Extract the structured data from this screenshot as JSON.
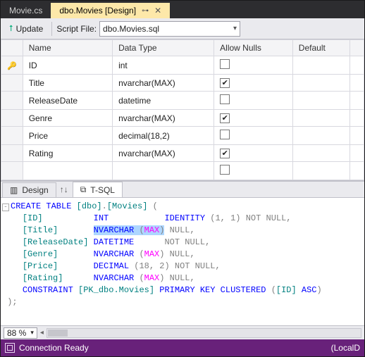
{
  "tabs": {
    "inactive": "Movie.cs",
    "active": "dbo.Movies [Design]"
  },
  "toolbar": {
    "update": "Update",
    "scriptFileLabel": "Script File:",
    "scriptFileValue": "dbo.Movies.sql"
  },
  "grid": {
    "headers": {
      "name": "Name",
      "dataType": "Data Type",
      "allowNulls": "Allow Nulls",
      "default": "Default"
    },
    "rows": [
      {
        "key": true,
        "name": "ID",
        "type": "int",
        "nulls": false
      },
      {
        "key": false,
        "name": "Title",
        "type": "nvarchar(MAX)",
        "nulls": true
      },
      {
        "key": false,
        "name": "ReleaseDate",
        "type": "datetime",
        "nulls": false
      },
      {
        "key": false,
        "name": "Genre",
        "type": "nvarchar(MAX)",
        "nulls": true
      },
      {
        "key": false,
        "name": "Price",
        "type": "decimal(18,2)",
        "nulls": false
      },
      {
        "key": false,
        "name": "Rating",
        "type": "nvarchar(MAX)",
        "nulls": true
      },
      {
        "key": false,
        "name": "",
        "type": "",
        "nulls": false
      }
    ]
  },
  "lowerTabs": {
    "design": "Design",
    "tsql": "T-SQL"
  },
  "sql": {
    "line1_a": "CREATE TABLE",
    "line1_b": " [dbo]",
    "line1_c": ".",
    "line1_d": "[Movies] ",
    "line1_e": "(",
    "id_col": "[ID]          ",
    "id_type": "INT           ",
    "id_ident": "IDENTITY ",
    "id_args": "(1, 1)",
    "id_null": " NOT NULL,",
    "title_col": "[Title]       ",
    "title_type": "NVARCHAR ",
    "title_max": "(MAX)",
    "title_null": " NULL,",
    "rel_col": "[ReleaseDate] ",
    "rel_type": "DATETIME      ",
    "rel_null": "NOT NULL,",
    "genre_col": "[Genre]       ",
    "genre_type": "NVARCHAR ",
    "genre_max": "(MAX)",
    "genre_null": " NULL,",
    "price_col": "[Price]       ",
    "price_type": "DECIMAL ",
    "price_args": "(18, 2)",
    "price_null": " NOT NULL,",
    "rating_col": "[Rating]      ",
    "rating_type": "NVARCHAR ",
    "rating_max": "(MAX)",
    "rating_null": " NULL,",
    "cons_kw": "CONSTRAINT",
    "cons_name": " [PK_dbo.Movies] ",
    "cons_pk": "PRIMARY KEY CLUSTERED ",
    "cons_open": "(",
    "cons_col": "[ID] ",
    "cons_asc": "ASC",
    "cons_close": ")",
    "end": ");"
  },
  "zoom": "88 %",
  "status": {
    "text": "Connection Ready",
    "right": "(LocalD"
  }
}
